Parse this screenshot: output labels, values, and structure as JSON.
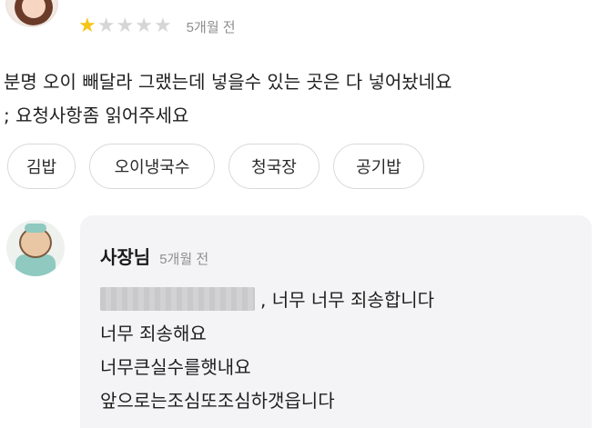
{
  "review": {
    "rating": 1,
    "rating_max": 5,
    "time": "5개월 전",
    "lines": [
      "분명 오이 빼달라 그랬는데 넣을수 있는 곳은 다 넣어놨네요",
      "; 요청사항좀 읽어주세요"
    ],
    "tags": [
      "김밥",
      "오이냉국수",
      "청국장",
      "공기밥"
    ]
  },
  "reply": {
    "name": "사장님",
    "time": "5개월 전",
    "line1_suffix": ", 너무 너무 죄송합니다",
    "lines": [
      "너무 죄송해요",
      "너무큰실수를햇내요",
      "앞으로는조심또조심하갯읍니다"
    ]
  },
  "icons": {
    "star": "star-icon",
    "reviewer_avatar": "reviewer-avatar",
    "owner_avatar": "owner-avatar"
  },
  "colors": {
    "star_filled": "#f5c518",
    "star_empty": "#d6d6d6",
    "reply_background": "#f4f4f6"
  }
}
